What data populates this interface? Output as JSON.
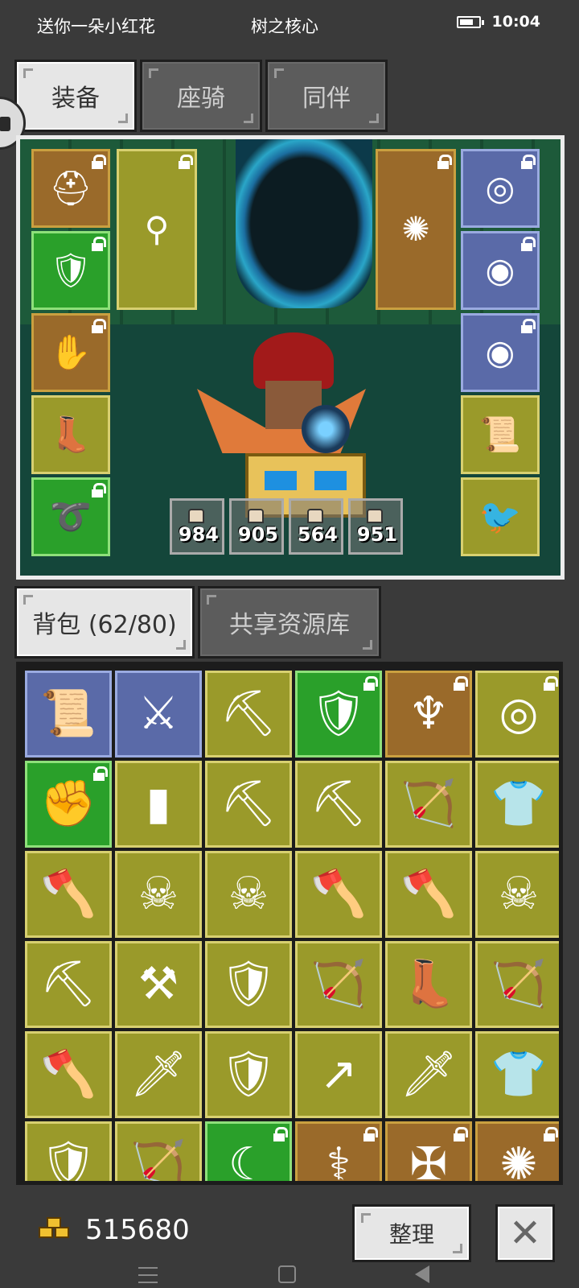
{
  "statusbar": {
    "left_text": "送你一朵小红花",
    "center_text": "树之核心",
    "time": "10:04"
  },
  "equip_tabs": [
    {
      "label": "装备",
      "active": true
    },
    {
      "label": "座骑",
      "active": false
    },
    {
      "label": "同伴",
      "active": false
    }
  ],
  "equipment": {
    "left_slots": [
      {
        "icon": "red-helmet-icon",
        "glyph": "⛑",
        "rarity": "orange",
        "locked": true
      },
      {
        "icon": "blue-armor-icon",
        "glyph": "🛡",
        "rarity": "green",
        "locked": true
      },
      {
        "icon": "red-gloves-icon",
        "glyph": "✋",
        "rarity": "orange",
        "locked": true
      },
      {
        "icon": "boots-icon",
        "glyph": "👢",
        "rarity": "yellow",
        "locked": false
      },
      {
        "icon": "belt-icon",
        "glyph": "➰",
        "rarity": "green",
        "locked": true
      }
    ],
    "weapon_slot": {
      "icon": "scepter-icon",
      "glyph": "⚲",
      "locked": true
    },
    "offhand_slot": {
      "icon": "spiked-orb-icon",
      "glyph": "✺",
      "locked": true
    },
    "right_slots": [
      {
        "icon": "emerald-amulet-icon",
        "glyph": "◎",
        "rarity": "blue",
        "locked": true
      },
      {
        "icon": "ruby-ring-icon",
        "glyph": "◉",
        "rarity": "blue",
        "locked": true
      },
      {
        "icon": "ruby-ring-icon",
        "glyph": "◉",
        "rarity": "blue",
        "locked": true
      },
      {
        "icon": "scroll-icon",
        "glyph": "📜",
        "rarity": "yellow",
        "locked": false
      },
      {
        "icon": "magpie-pet-icon",
        "glyph": "🐦",
        "rarity": "yellow",
        "locked": false
      }
    ],
    "stats": [
      "984",
      "905",
      "564",
      "951"
    ]
  },
  "inventory_tabs": [
    {
      "label": "背包 (62/80)",
      "active": true
    },
    {
      "label": "共享资源库",
      "active": false
    }
  ],
  "inventory": [
    {
      "icon": "scroll-icon",
      "glyph": "📜",
      "rarity": "blue",
      "locked": false
    },
    {
      "icon": "crossed-swords-icon",
      "glyph": "⚔",
      "rarity": "blue",
      "locked": false
    },
    {
      "icon": "pickaxe-icon",
      "glyph": "⛏",
      "rarity": "yellow",
      "locked": false
    },
    {
      "icon": "dark-armor-icon",
      "glyph": "🛡",
      "rarity": "green",
      "locked": true
    },
    {
      "icon": "horned-amulet-icon",
      "glyph": "♆",
      "rarity": "orange",
      "locked": true
    },
    {
      "icon": "emerald-amulet-icon",
      "glyph": "◎",
      "rarity": "yellow",
      "locked": true
    },
    {
      "icon": "blue-gauntlet-icon",
      "glyph": "✊",
      "rarity": "green",
      "locked": true
    },
    {
      "icon": "red-shield-icon",
      "glyph": "▮",
      "rarity": "yellow",
      "locked": false
    },
    {
      "icon": "red-pickaxe-icon",
      "glyph": "⛏",
      "rarity": "yellow",
      "locked": false
    },
    {
      "icon": "red-pickaxe-icon",
      "glyph": "⛏",
      "rarity": "yellow",
      "locked": false
    },
    {
      "icon": "red-bow-icon",
      "glyph": "🏹",
      "rarity": "yellow",
      "locked": false
    },
    {
      "icon": "red-armor-icon",
      "glyph": "👕",
      "rarity": "yellow",
      "locked": false
    },
    {
      "icon": "red-axe-icon",
      "glyph": "🪓",
      "rarity": "yellow",
      "locked": false
    },
    {
      "icon": "skull-helm-icon",
      "glyph": "☠",
      "rarity": "yellow",
      "locked": false
    },
    {
      "icon": "skull-helm-icon",
      "glyph": "☠",
      "rarity": "yellow",
      "locked": false
    },
    {
      "icon": "red-axe-icon",
      "glyph": "🪓",
      "rarity": "yellow",
      "locked": false
    },
    {
      "icon": "red-axe-icon",
      "glyph": "🪓",
      "rarity": "yellow",
      "locked": false
    },
    {
      "icon": "skull-helm-icon",
      "glyph": "☠",
      "rarity": "yellow",
      "locked": false
    },
    {
      "icon": "red-pickaxe-icon",
      "glyph": "⛏",
      "rarity": "yellow",
      "locked": false
    },
    {
      "icon": "mace-icon",
      "glyph": "⚒",
      "rarity": "yellow",
      "locked": false
    },
    {
      "icon": "iron-armor-icon",
      "glyph": "🛡",
      "rarity": "yellow",
      "locked": false
    },
    {
      "icon": "red-bow-icon",
      "glyph": "🏹",
      "rarity": "yellow",
      "locked": false
    },
    {
      "icon": "red-boots-icon",
      "glyph": "👢",
      "rarity": "yellow",
      "locked": false
    },
    {
      "icon": "bow-icon",
      "glyph": "🏹",
      "rarity": "yellow",
      "locked": false
    },
    {
      "icon": "red-axe-icon",
      "glyph": "🪓",
      "rarity": "yellow",
      "locked": false
    },
    {
      "icon": "red-sword-icon",
      "glyph": "🗡",
      "rarity": "yellow",
      "locked": false
    },
    {
      "icon": "iron-armor-icon",
      "glyph": "🛡",
      "rarity": "yellow",
      "locked": false
    },
    {
      "icon": "red-spear-icon",
      "glyph": "↗",
      "rarity": "yellow",
      "locked": false
    },
    {
      "icon": "red-sword-icon",
      "glyph": "🗡",
      "rarity": "yellow",
      "locked": false
    },
    {
      "icon": "red-armor-icon",
      "glyph": "👕",
      "rarity": "yellow",
      "locked": false
    },
    {
      "icon": "iron-armor-icon",
      "glyph": "🛡",
      "rarity": "yellow",
      "locked": false
    },
    {
      "icon": "red-bow-icon",
      "glyph": "🏹",
      "rarity": "yellow",
      "locked": false
    },
    {
      "icon": "scythe-icon",
      "glyph": "☾",
      "rarity": "green",
      "locked": true
    },
    {
      "icon": "green-staff-icon",
      "glyph": "⚕",
      "rarity": "orange",
      "locked": true
    },
    {
      "icon": "crossbow-icon",
      "glyph": "✠",
      "rarity": "orange",
      "locked": true
    },
    {
      "icon": "spiked-orb-icon",
      "glyph": "✺",
      "rarity": "orange",
      "locked": true
    }
  ],
  "gold": "515680",
  "sort_button": "整理",
  "close_button": "✕",
  "colors": {
    "yellow_slot": "#9a9a2a",
    "green_slot": "#2aa02a",
    "orange_slot": "#9a6a2a",
    "blue_slot": "#5a6aa8"
  }
}
